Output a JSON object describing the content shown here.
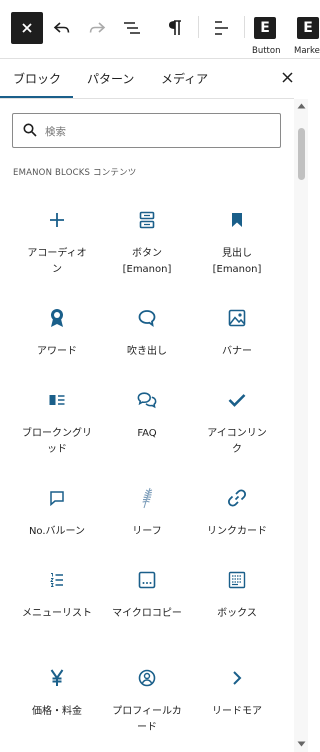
{
  "toolbar": {
    "buttons": [
      {
        "name": "close",
        "icon": "close-icon"
      },
      {
        "name": "undo",
        "icon": "undo-icon"
      },
      {
        "name": "redo",
        "icon": "redo-icon"
      },
      {
        "name": "list-view",
        "icon": "list-view-icon"
      },
      {
        "name": "paragraph",
        "icon": "paragraph-icon"
      },
      {
        "name": "align",
        "icon": "align-icon"
      }
    ],
    "e_button_1": {
      "letter": "E",
      "label": "Button"
    },
    "e_button_2": {
      "letter": "E",
      "label": "Marke"
    }
  },
  "tabs": [
    {
      "label": "ブロック",
      "active": true
    },
    {
      "label": "パターン",
      "active": false
    },
    {
      "label": "メディア",
      "active": false
    }
  ],
  "search": {
    "placeholder": "検索"
  },
  "section_title": "EMANON BLOCKS コンテンツ",
  "accent_color": "#1a5f8a",
  "blocks": [
    {
      "icon": "plus-icon",
      "label": "アコーディオン"
    },
    {
      "icon": "button-icon",
      "label": "ボタン [Emanon]"
    },
    {
      "icon": "bookmark-icon",
      "label": "見出し [Emanon]"
    },
    {
      "icon": "award-icon",
      "label": "アワード"
    },
    {
      "icon": "speech-bubble-icon",
      "label": "吹き出し"
    },
    {
      "icon": "image-icon",
      "label": "バナー"
    },
    {
      "icon": "block-list-icon",
      "label": "ブロークングリッド"
    },
    {
      "icon": "faq-icon",
      "label": "FAQ"
    },
    {
      "icon": "check-icon",
      "label": "アイコンリンク"
    },
    {
      "icon": "comment-icon",
      "label": "No.バルーン"
    },
    {
      "icon": "leaf-icon",
      "label": "リーフ"
    },
    {
      "icon": "link-icon",
      "label": "リンクカード"
    },
    {
      "icon": "numbered-list-icon",
      "label": "メニューリスト"
    },
    {
      "icon": "micro-copy-icon",
      "label": "マイクロコピー"
    },
    {
      "icon": "box-icon",
      "label": "ボックス"
    },
    {
      "icon": "yen-icon",
      "label": "価格・料金"
    },
    {
      "icon": "profile-icon",
      "label": "プロフィールカード"
    },
    {
      "icon": "chevron-right-icon",
      "label": "リードモア"
    }
  ]
}
